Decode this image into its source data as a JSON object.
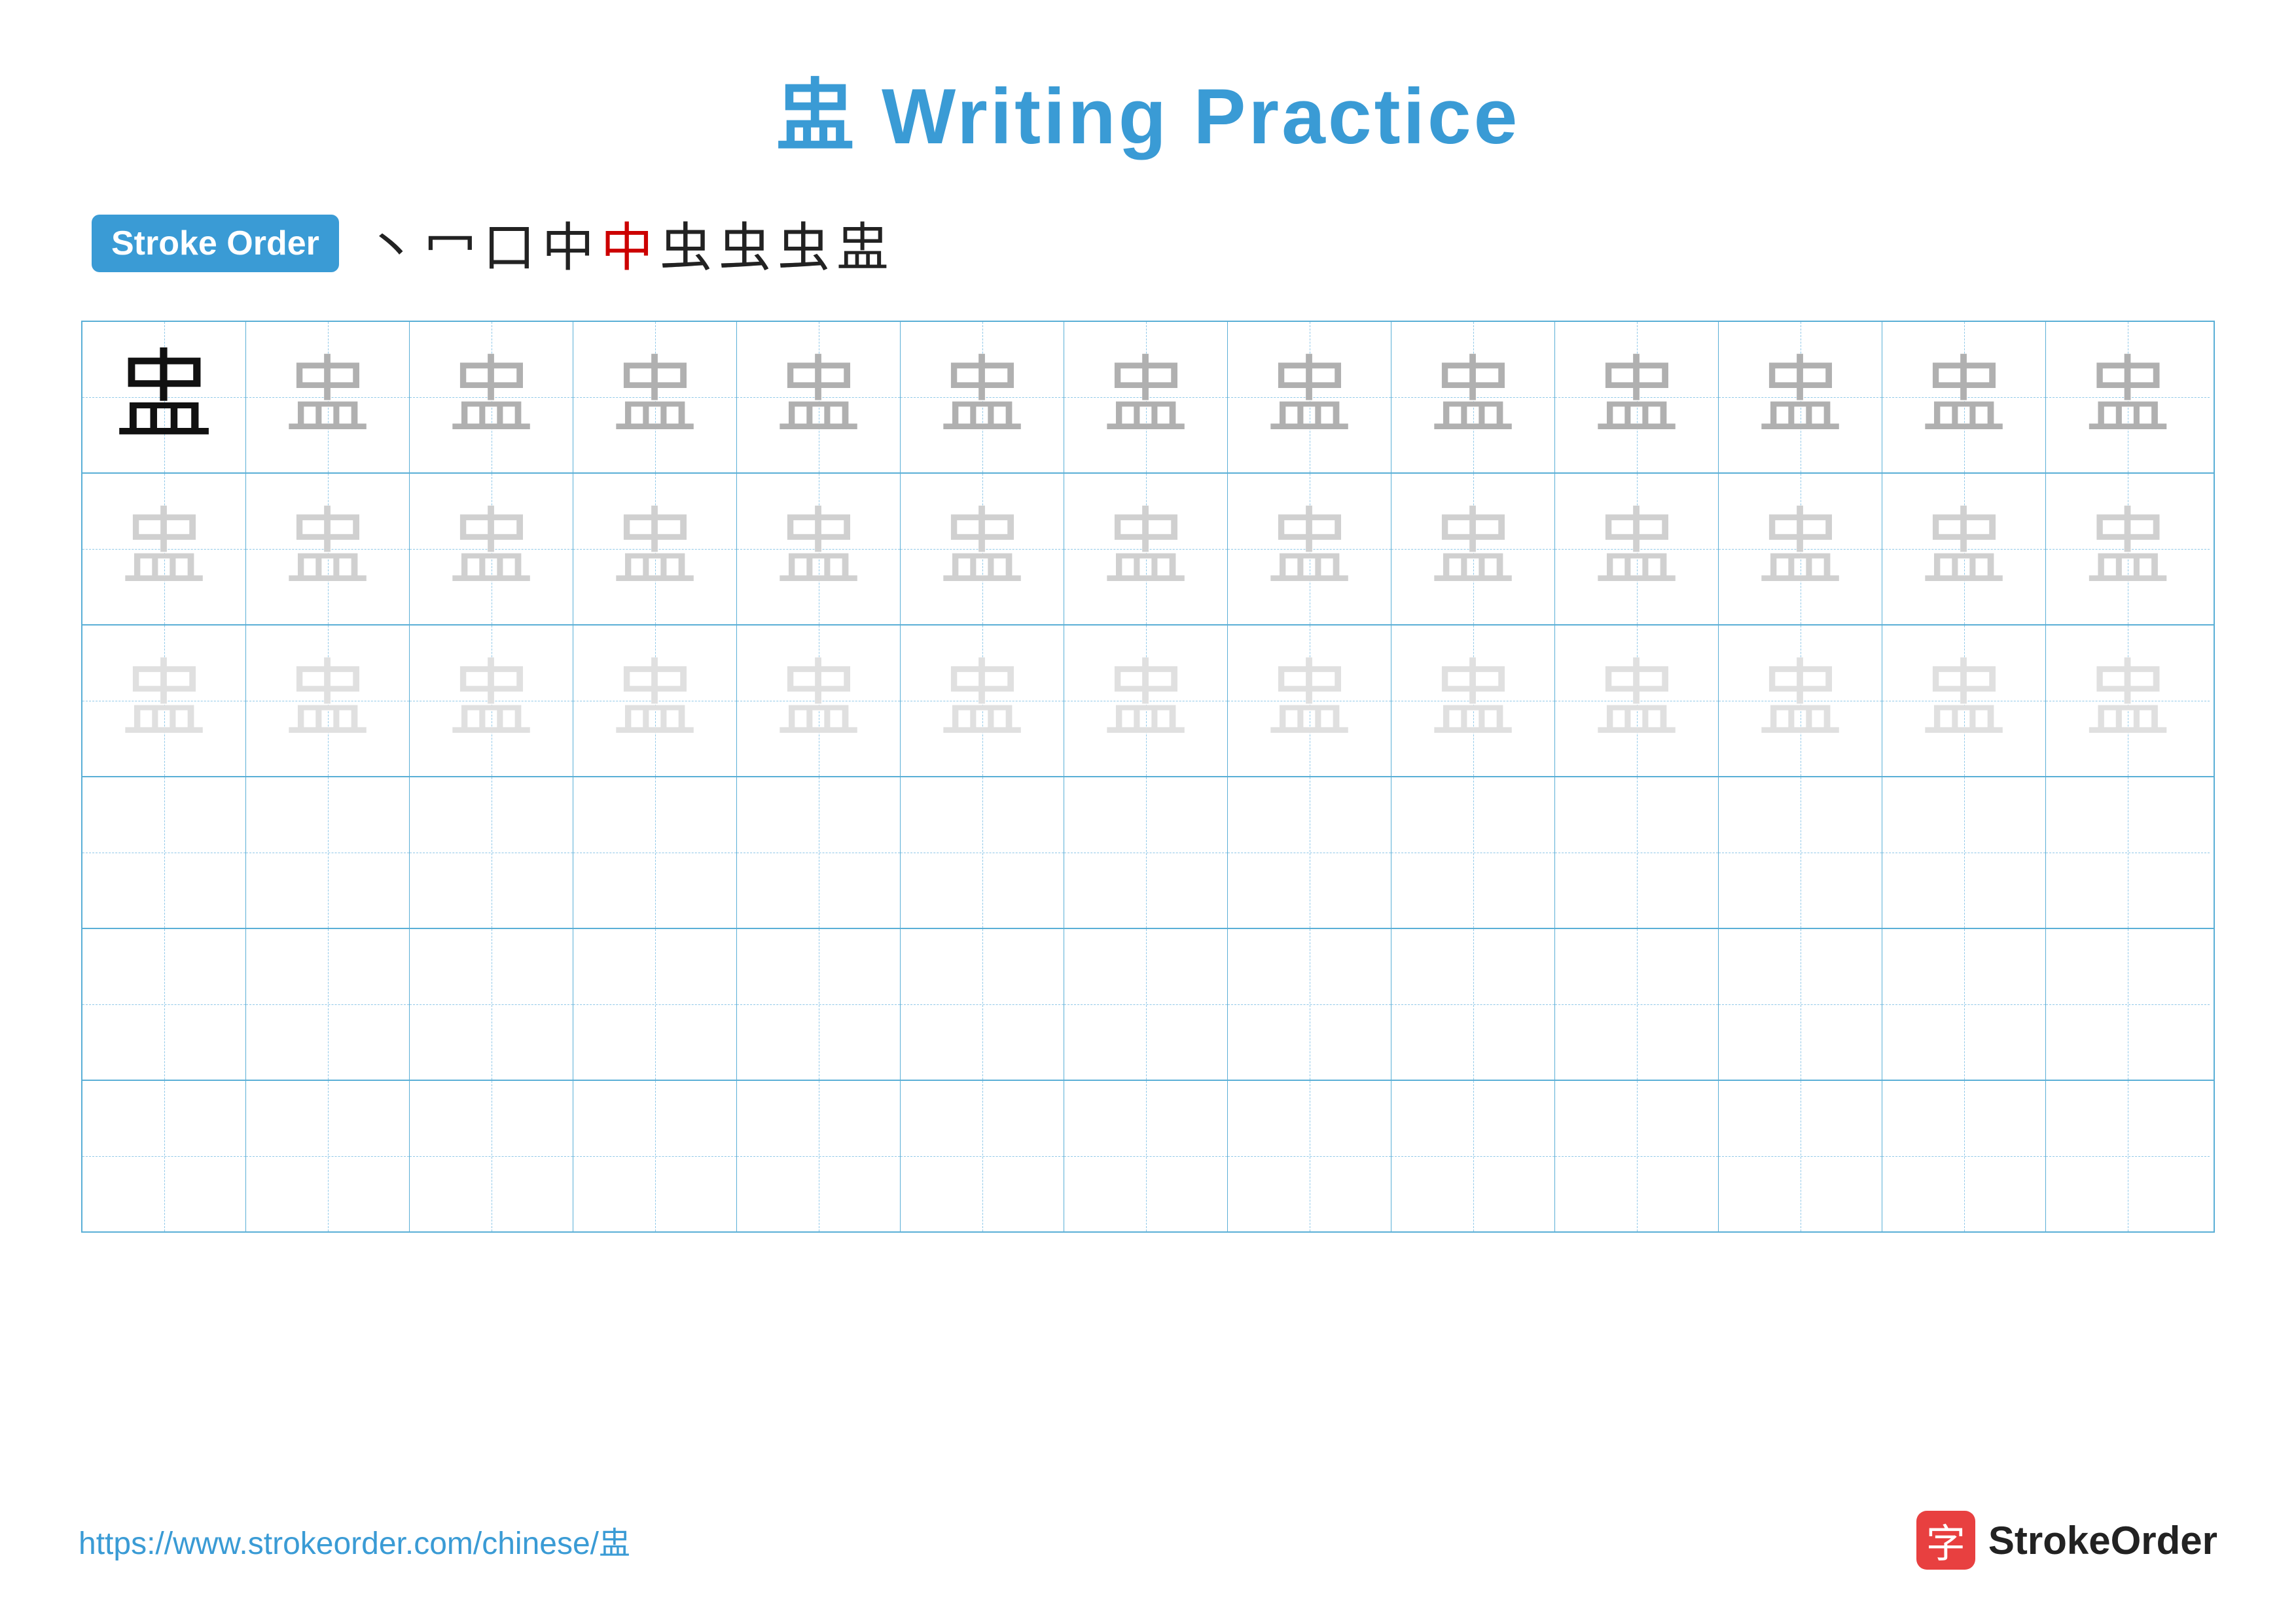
{
  "title": "盅 Writing Practice",
  "stroke_order": {
    "label": "Stroke Order",
    "strokes": [
      "丶",
      "冖",
      "口",
      "中",
      "中",
      "虫",
      "虫",
      "虫",
      "盅"
    ]
  },
  "grid": {
    "rows": 6,
    "cols": 13,
    "character": "盅"
  },
  "footer": {
    "url": "https://www.strokeorder.com/chinese/盅",
    "logo_char": "字",
    "logo_text": "StrokeOrder"
  }
}
